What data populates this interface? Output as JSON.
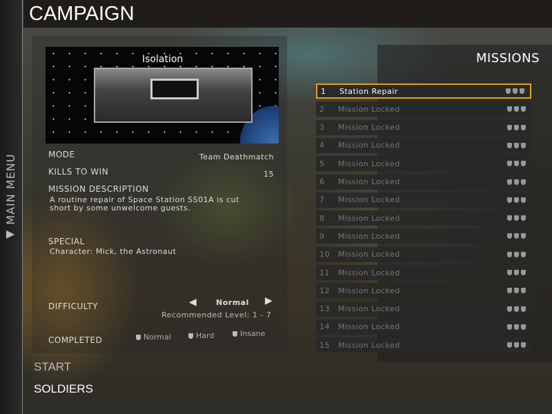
{
  "side_menu": {
    "label": "MAIN MENU",
    "icon": "triangle-up-icon"
  },
  "header": {
    "title": "CAMPAIGN"
  },
  "preview": {
    "map_name": "Isolation"
  },
  "details": {
    "mode_label": "MODE",
    "mode_value": "Team Deathmatch",
    "kills_label": "KILLS TO WIN",
    "kills_value": "15",
    "description_label": "MISSION DESCRIPTION",
    "description": "A routine repair of Space Station SS01A is cut short by some unwelcome guests.",
    "special_label": "SPECIAL",
    "special_value": "Character: Mick, the Astronaut",
    "difficulty_label": "DIFFICULTY",
    "difficulty_value": "Normal",
    "recommended": "Recommended Level: 1 - 7",
    "completed_label": "COMPLETED",
    "completed": [
      "Normal",
      "Hard",
      "Insane"
    ]
  },
  "menu": {
    "start": "START",
    "soldiers": "SOLDIERS"
  },
  "missions": {
    "title": "MISSIONS",
    "accent": "#e8a020",
    "items": [
      {
        "num": "1",
        "name": "Station Repair",
        "selected": true
      },
      {
        "num": "2",
        "name": "Mission Locked"
      },
      {
        "num": "3",
        "name": "Mission Locked"
      },
      {
        "num": "4",
        "name": "Mission Locked"
      },
      {
        "num": "5",
        "name": "Mission Locked"
      },
      {
        "num": "6",
        "name": "Mission Locked"
      },
      {
        "num": "7",
        "name": "Mission Locked"
      },
      {
        "num": "8",
        "name": "Mission Locked"
      },
      {
        "num": "9",
        "name": "Mission Locked"
      },
      {
        "num": "10",
        "name": "Mission Locked"
      },
      {
        "num": "11",
        "name": "Mission Locked"
      },
      {
        "num": "12",
        "name": "Mission Locked"
      },
      {
        "num": "13",
        "name": "Mission Locked"
      },
      {
        "num": "14",
        "name": "Mission Locked"
      },
      {
        "num": "15",
        "name": "Mission Locked"
      }
    ]
  }
}
